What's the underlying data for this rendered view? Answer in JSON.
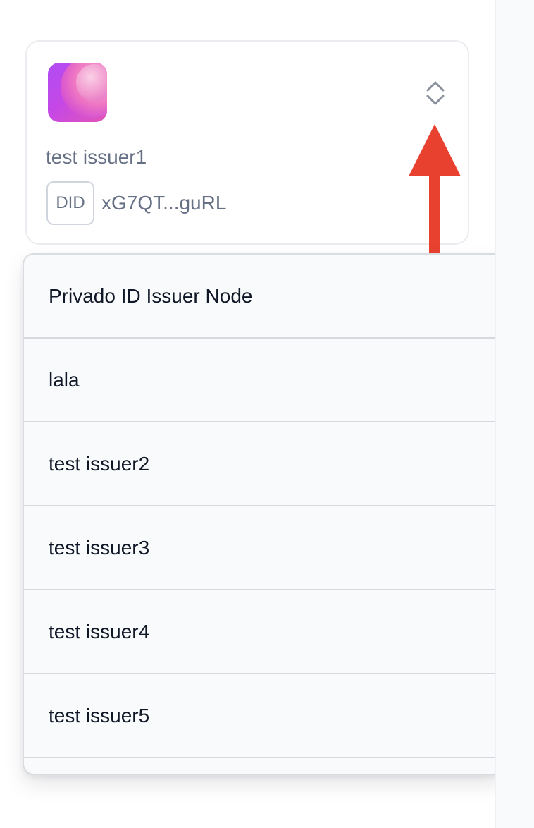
{
  "issuer": {
    "name": "test issuer1",
    "did_badge": "DID",
    "did_short": "xG7QT...guRL",
    "logo_icon": "gradient-orb-logo-icon",
    "toggle_icon": "chevron-up-down-icon"
  },
  "dropdown": {
    "options": [
      {
        "label": "Privado ID Issuer Node"
      },
      {
        "label": "lala"
      },
      {
        "label": "test issuer2"
      },
      {
        "label": "test issuer3"
      },
      {
        "label": "test issuer4"
      },
      {
        "label": "test issuer5"
      }
    ]
  },
  "annotation": {
    "arrow_color": "#e84130",
    "arrow_direction": "up"
  }
}
